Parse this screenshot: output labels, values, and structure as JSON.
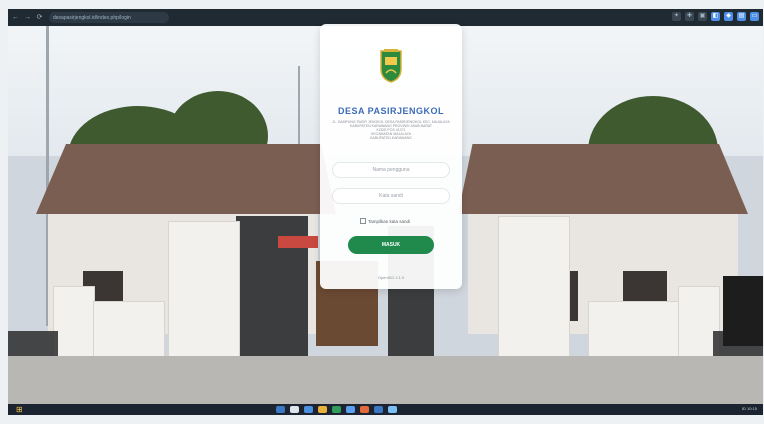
{
  "browser": {
    "url": "desapasirjengkol.id/index.php/login",
    "nav_back": "←",
    "nav_forward": "→",
    "nav_reload": "⟳",
    "extensions": [
      "✦",
      "✚",
      "▣",
      "◧",
      "◆",
      "▤",
      "▭"
    ]
  },
  "login": {
    "title": "DESA PASIRJENGKOL",
    "subtitle_lines": [
      "JL. KAMPUNG PASIR JENGKOL DESA PASIRJENGKOL KEC. MAJALAYA",
      "KABUPATEN KARAWANG PROVINSI JAWA BARAT",
      "KODE POS 41371",
      "KECAMATAN MAJALAYA",
      "KABUPATEN KARAWANG"
    ],
    "username_placeholder": "Nama pengguna",
    "password_placeholder": "Kata sandi",
    "show_password_label": "Tampilkan kata sandi",
    "submit_label": "MASUK",
    "version_text": "OpenSID 2.1.0"
  },
  "taskbar": {
    "start_glyph": "⊞",
    "tray_text": "ID 10:15"
  },
  "colors": {
    "accent_green": "#1f8a4c",
    "title_blue": "#3b6cb7",
    "roof_brown": "#7b5e52"
  }
}
